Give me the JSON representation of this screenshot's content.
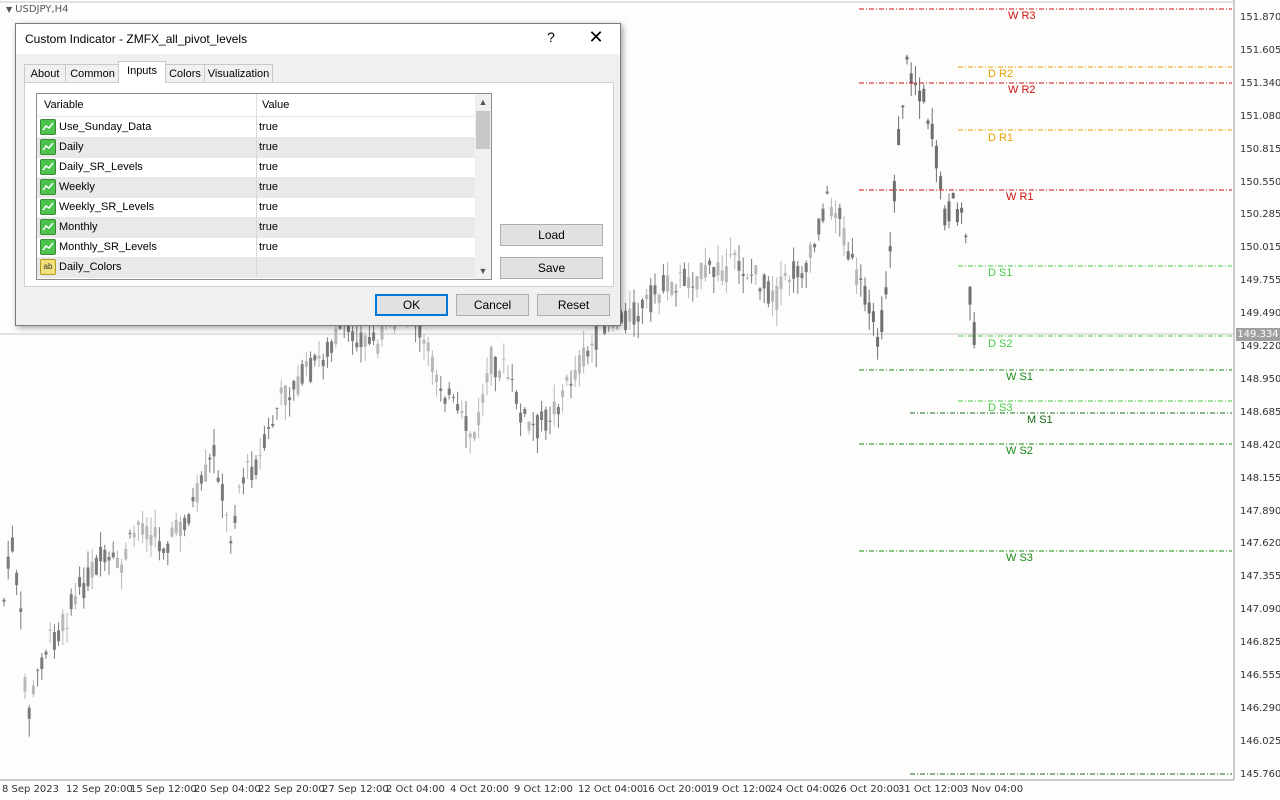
{
  "chart": {
    "symbol": "USDJPY,H4",
    "current_price": "149.334",
    "price_axis": [
      "151.870",
      "151.605",
      "151.340",
      "151.080",
      "150.815",
      "150.550",
      "150.285",
      "150.015",
      "149.755",
      "149.490",
      "149.220",
      "148.950",
      "148.685",
      "148.420",
      "148.155",
      "147.890",
      "147.620",
      "147.355",
      "147.090",
      "146.825",
      "146.555",
      "146.290",
      "146.025",
      "145.760"
    ],
    "time_axis": [
      "8 Sep 2023",
      "12 Sep 20:00",
      "15 Sep 12:00",
      "20 Sep 04:00",
      "22 Sep 20:00",
      "27 Sep 12:00",
      "2 Oct 04:00",
      "4 Oct 20:00",
      "9 Oct 12:00",
      "12 Oct 04:00",
      "16 Oct 20:00",
      "19 Oct 12:00",
      "24 Oct 04:00",
      "26 Oct 20:00",
      "31 Oct 12:00",
      "3 Nov 04:00"
    ],
    "pivot_levels": [
      {
        "label": "W R3",
        "color": "#d01010"
      },
      {
        "label": "D R2",
        "color": "#e8a000"
      },
      {
        "label": "W R2",
        "color": "#d01010"
      },
      {
        "label": "D R1",
        "color": "#e8a000"
      },
      {
        "label": "W R1",
        "color": "#d01010"
      },
      {
        "label": "D S1",
        "color": "#44cc44"
      },
      {
        "label": "D S2",
        "color": "#44cc44"
      },
      {
        "label": "W S1",
        "color": "#1a8a1a"
      },
      {
        "label": "D S3",
        "color": "#44cc44"
      },
      {
        "label": "M S1",
        "color": "#1a6a1a"
      },
      {
        "label": "W S2",
        "color": "#1a8a1a"
      },
      {
        "label": "W S3",
        "color": "#1a8a1a"
      }
    ]
  },
  "dialog": {
    "title": "Custom Indicator - ZMFX_all_pivot_levels",
    "help_label": "?",
    "close_label": "✕",
    "tabs": [
      "About",
      "Common",
      "Inputs",
      "Colors",
      "Visualization"
    ],
    "active_tab": "Inputs",
    "columns": {
      "variable": "Variable",
      "value": "Value"
    },
    "rows": [
      {
        "variable": "Use_Sunday_Data",
        "value": "true",
        "icon": "bool-icon"
      },
      {
        "variable": "Daily",
        "value": "true",
        "icon": "bool-icon"
      },
      {
        "variable": "Daily_SR_Levels",
        "value": "true",
        "icon": "bool-icon"
      },
      {
        "variable": "Weekly",
        "value": "true",
        "icon": "bool-icon"
      },
      {
        "variable": "Weekly_SR_Levels",
        "value": "true",
        "icon": "bool-icon"
      },
      {
        "variable": "Monthly",
        "value": "true",
        "icon": "bool-icon"
      },
      {
        "variable": "Monthly_SR_Levels",
        "value": "true",
        "icon": "bool-icon"
      },
      {
        "variable": "Daily_Colors",
        "value": "",
        "icon": "string-icon",
        "icon_text": "ab"
      }
    ],
    "buttons": {
      "load": "Load",
      "save": "Save",
      "ok": "OK",
      "cancel": "Cancel",
      "reset": "Reset"
    }
  }
}
